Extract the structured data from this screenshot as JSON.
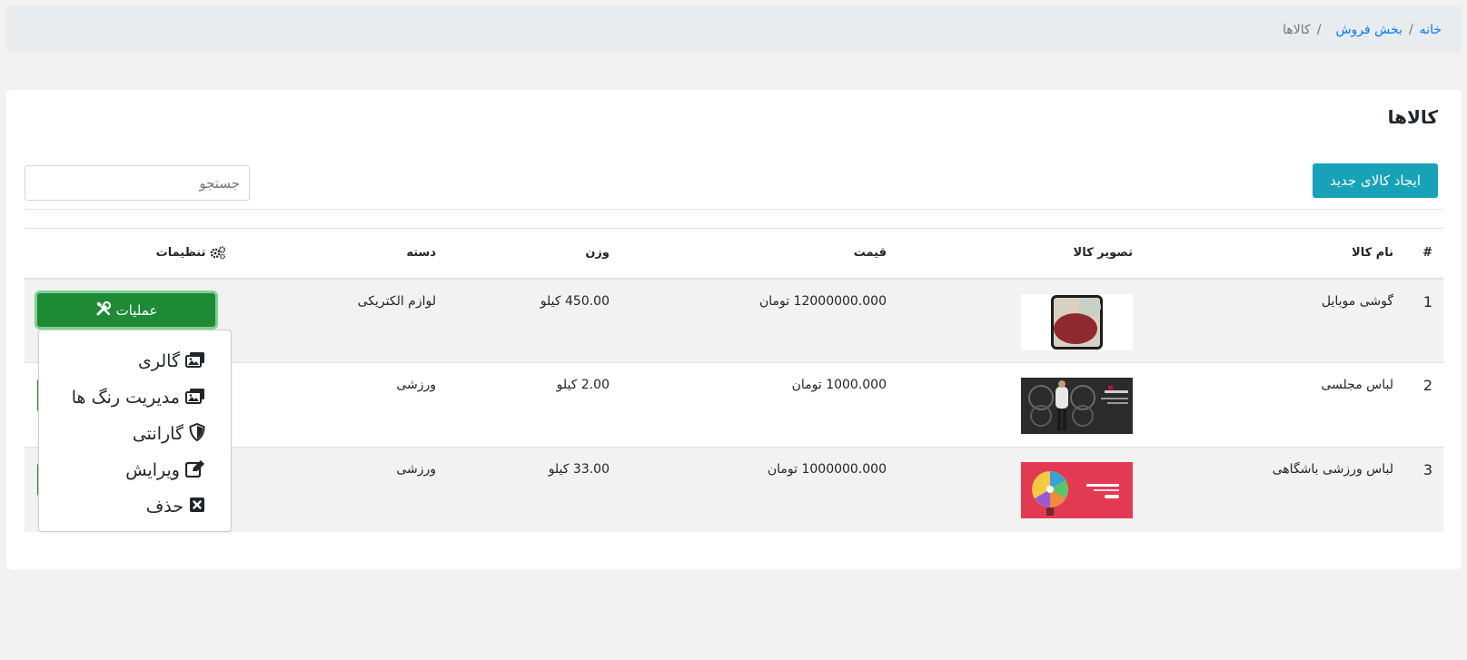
{
  "breadcrumb": {
    "home": "خانه",
    "section": "بخش فروش",
    "current": "کالاها",
    "separator": "/"
  },
  "page": {
    "title": "کالاها",
    "create_button": "ایجاد کالای جدید",
    "search_placeholder": "جستجو"
  },
  "table": {
    "headers": {
      "index": "#",
      "name": "نام کالا",
      "image": "تصویر کالا",
      "price": "قیمت",
      "weight": "وزن",
      "category": "دسته",
      "settings": "تنظیمات"
    },
    "rows": [
      {
        "index": "1",
        "name": "گوشی موبایل",
        "price": "12000000.000 تومان",
        "weight": "450.00 کیلو",
        "category": "لوازم الکتریکی"
      },
      {
        "index": "2",
        "name": "لباس مجلسی",
        "price": "1000.000 تومان",
        "weight": "2.00 کیلو",
        "category": "ورزشی"
      },
      {
        "index": "3",
        "name": "لباس ورزشی باشگاهی",
        "price": "1000000.000 تومان",
        "weight": "33.00 کیلو",
        "category": "ورزشی"
      }
    ]
  },
  "actions": {
    "operations_label": "عملیات",
    "menu": {
      "gallery": "گالری",
      "colors": "مدیریت رنگ ها",
      "warranty": "گارانتی",
      "edit": "ویرایش",
      "delete": "حذف"
    }
  },
  "colors": {
    "primary_link": "#007bff",
    "create_button": "#17a2b8",
    "operations_button": "#1e8a36",
    "breadcrumb_bg": "#e9ecef"
  },
  "icons": {
    "settings": "cogs-icon",
    "operations": "tools-icon",
    "gallery": "images-icon",
    "colors": "images-icon",
    "warranty": "shield-icon",
    "edit": "edit-icon",
    "delete": "close-box-icon"
  }
}
